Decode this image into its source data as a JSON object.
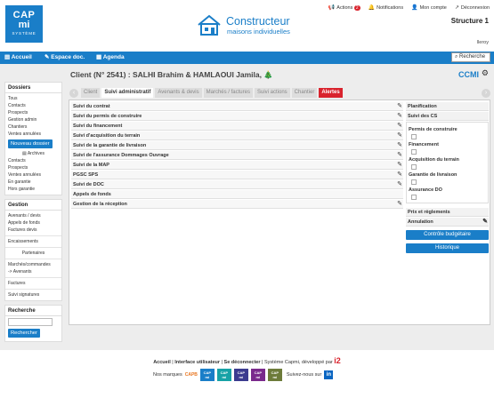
{
  "header": {
    "logo": {
      "line1": "CAP",
      "line2": "mi",
      "line3": "SYSTÈME"
    },
    "brand": {
      "title": "Constructeur",
      "subtitle": "maisons individuelles"
    },
    "links": {
      "actions": "Actions",
      "actions_count": "2",
      "notifications": "Notifications",
      "account": "Mon compte",
      "logout": "Déconnexion"
    },
    "structure": "Structure 1",
    "user": "lleroy"
  },
  "navbar": {
    "home": "Accueil",
    "docs": "Espace doc.",
    "agenda": "Agenda",
    "search": "Recherche"
  },
  "sidebar": {
    "dossiers_title": "Dossiers",
    "dossiers_links": [
      "Tous",
      "Contacts",
      "Prospects",
      "Gestion admin",
      "Chantiers",
      "Ventes annulées"
    ],
    "new_folder": "Nouveau dossier",
    "archives": "Archives",
    "archive_links": [
      "Contacts",
      "Prospects",
      "Ventes annulées",
      "En garantie",
      "Hors garantie"
    ],
    "gestion_title": "Gestion",
    "gestion_links1": [
      "Avenants / devis",
      "Appels de fonds",
      "Factures devis"
    ],
    "encaissements": "Encaissements",
    "partenaires": "Partenaires",
    "gestion_links2": [
      "Marchés/commandes",
      "-> Avenants"
    ],
    "factures": "Factures",
    "signatures": "Suivi signatures",
    "recherche_title": "Recherche",
    "recherche_btn": "Rechercher"
  },
  "main": {
    "title": "Client (N° 2541) : SALHI Brahim & HAMLAOUI Jamila,",
    "company": "CCMI",
    "tabs": [
      "Client",
      "Suivi administratif",
      "Avenants & devis",
      "Marchés / factures",
      "Suivi actions",
      "Chantier",
      "Alertes"
    ],
    "rows": [
      "Suivi du contrat",
      "Suivi du permis de construire",
      "Suivi du financement",
      "Suivi d'acquisition du terrain",
      "Suivi de la garantie de livraison",
      "Suivi de l'assurance Dommages Ouvrage",
      "Suivi de la MAP",
      "PGSC SPS",
      "Suivi de DOC",
      "Appels de fonds",
      "Gestion de la réception"
    ]
  },
  "right": {
    "planification": "Planification",
    "suivi_cs": "Suivi des CS",
    "cs_items": [
      "Permis de construire",
      "Financement",
      "Acquisition du terrain",
      "Garantie de livraison",
      "Assurance DO"
    ],
    "prix": "Prix et règlements",
    "annulation": "Annulation",
    "btn_controle": "Contrôle budgétaire",
    "btn_historique": "Historique"
  },
  "footer": {
    "home": "Accueil",
    "ui": "Interface utilisateur",
    "logout": "Se déconnecter",
    "dev": "Système Capmi, développé par",
    "i2": "i2",
    "nos_marques": "Nos marques",
    "suivez": "Suivez-nous sur",
    "linkedin": "in"
  }
}
